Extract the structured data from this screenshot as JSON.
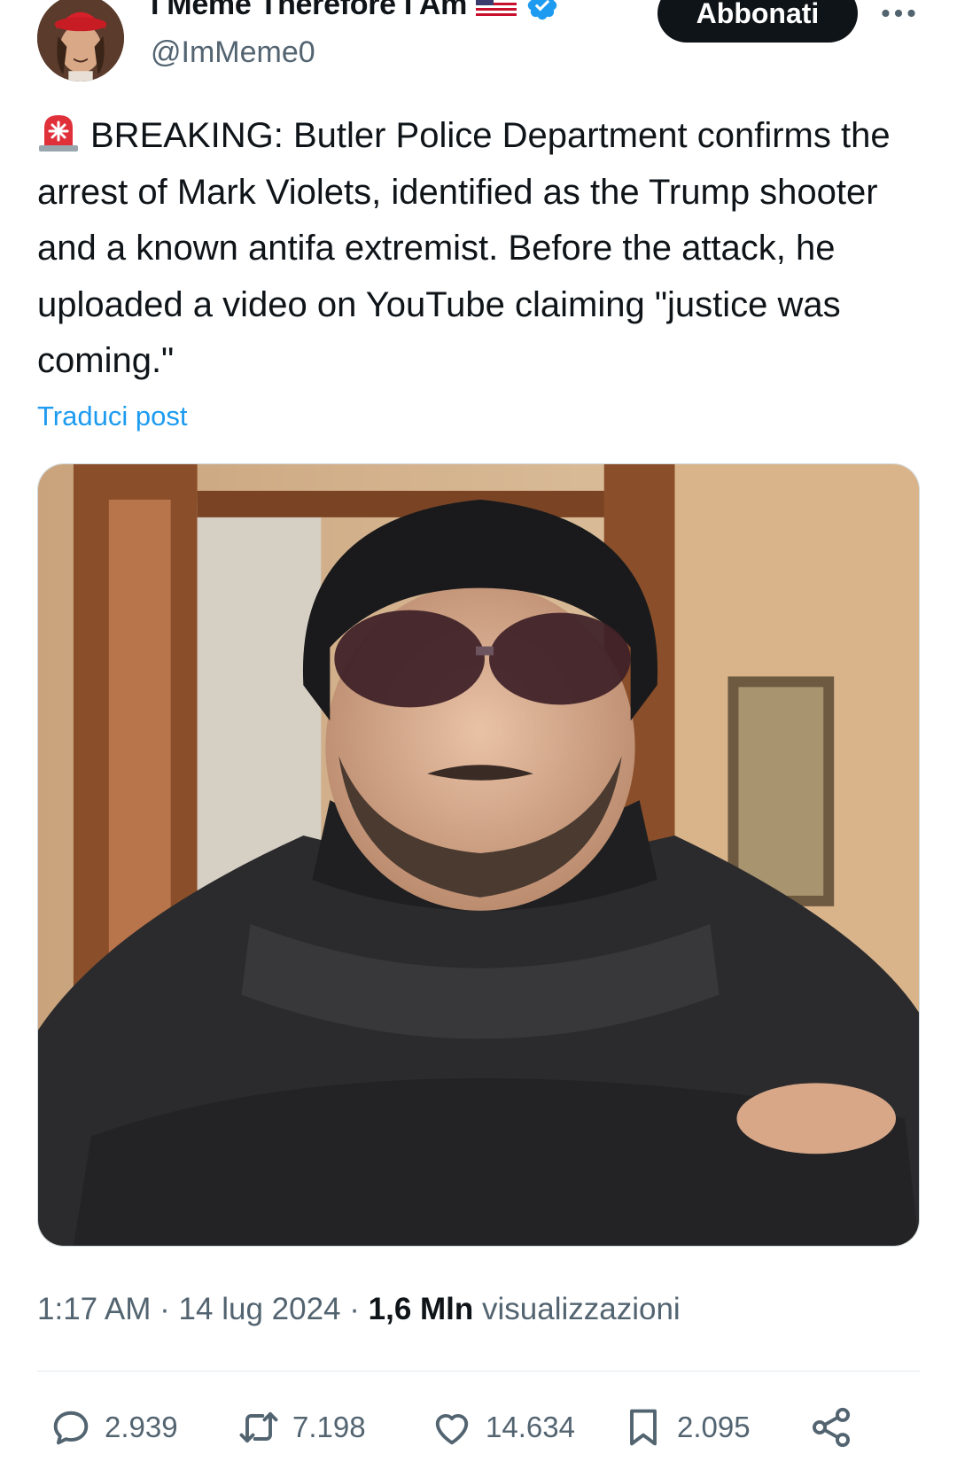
{
  "author": {
    "display_name": "I Meme Therefore I Am",
    "handle": "@ImMeme0",
    "flag_icon": "us-flag-icon",
    "verified_icon": "verified-badge-icon"
  },
  "header": {
    "subscribe_label": "Abbonati",
    "more_icon": "more-horizontal-icon"
  },
  "tweet": {
    "emoji_icon": "siren-icon",
    "text": "BREAKING: Butler Police Department confirms the arrest of Mark Violets, identified as the Trump shooter and a known antifa extremist. Before the attack, he uploaded a video on YouTube claiming \"justice was coming.\"",
    "translate_label": "Traduci post"
  },
  "meta": {
    "time": "1:17 AM",
    "sep1": "·",
    "date": "14 lug 2024",
    "sep2": "·",
    "views_count": "1,6 Mln",
    "views_label": "visualizzazioni"
  },
  "actions": {
    "replies": "2.939",
    "reposts": "7.198",
    "likes": "14.634",
    "bookmarks": "2.095"
  },
  "colors": {
    "accent": "#1d9bf0",
    "text": "#0f1419",
    "muted": "#536471",
    "button_bg": "#0f1419"
  }
}
